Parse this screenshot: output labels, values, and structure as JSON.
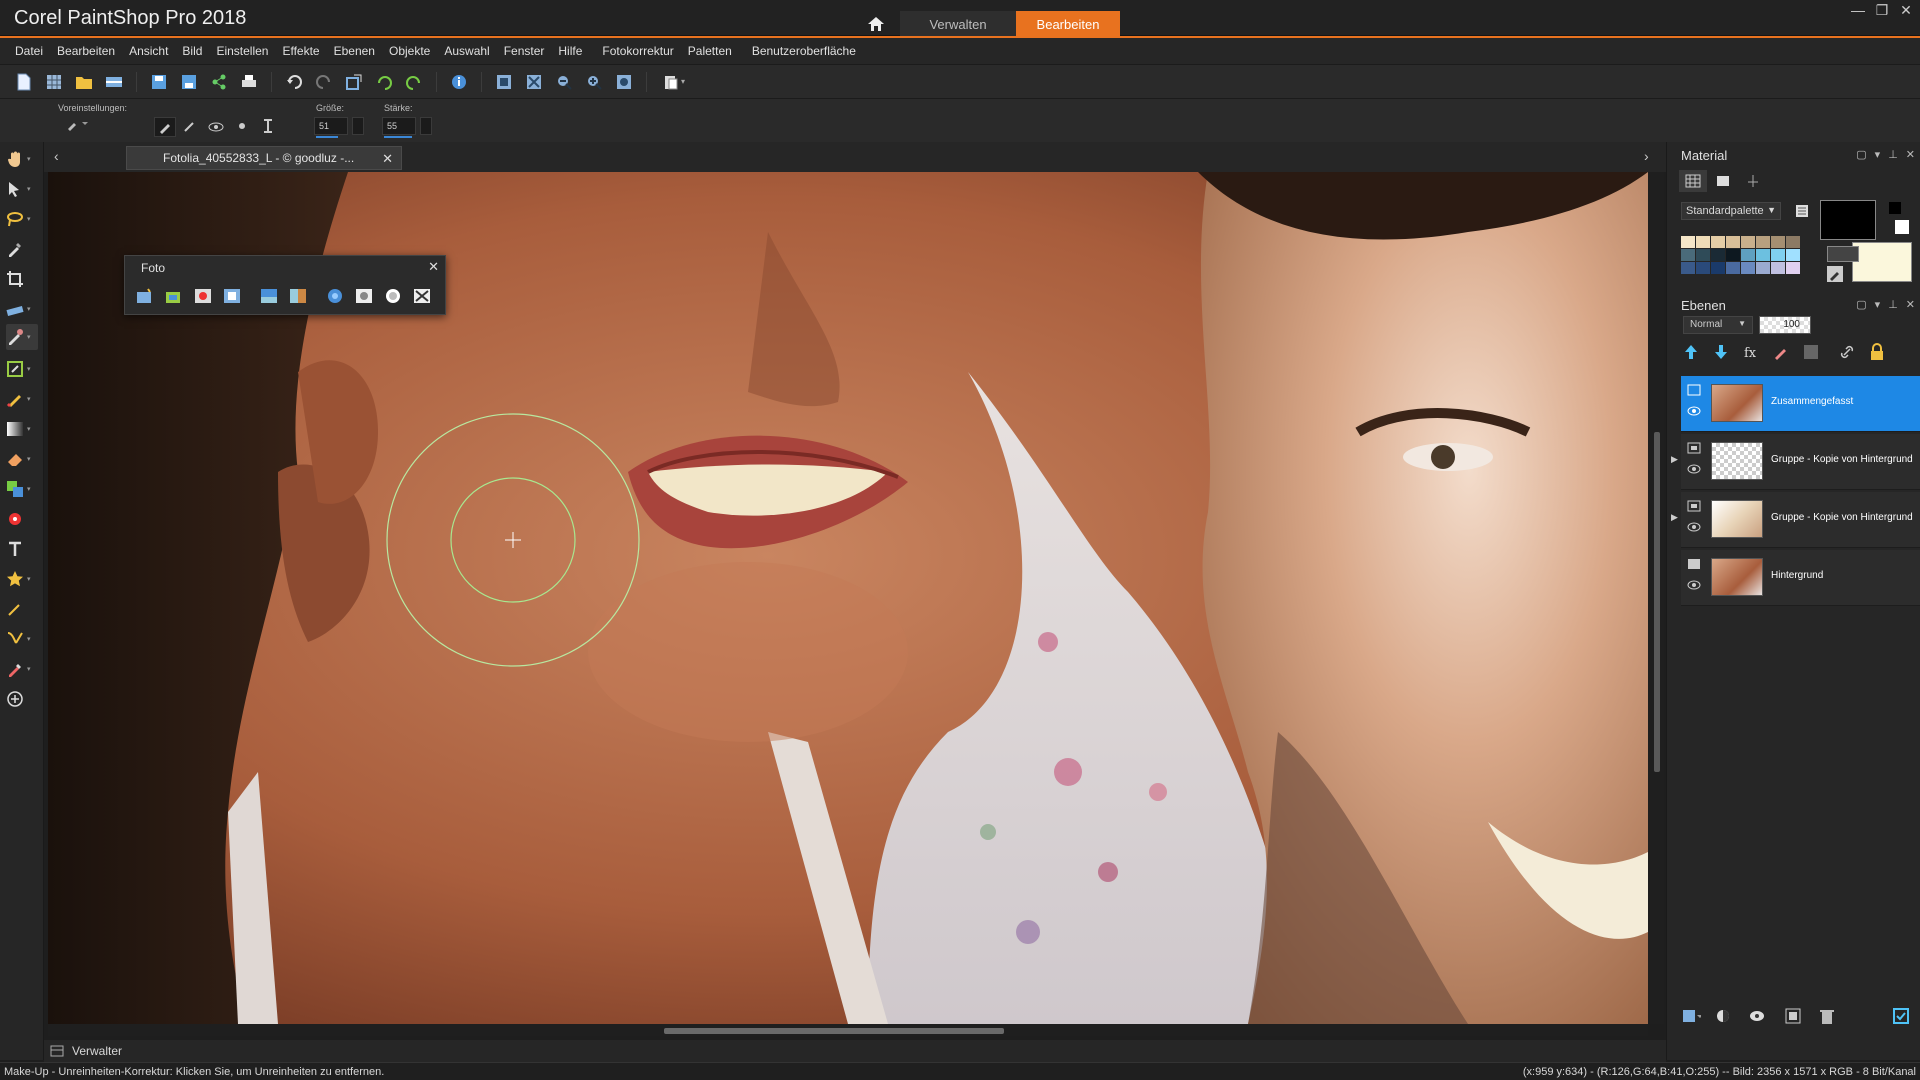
{
  "app": {
    "title": "Corel PaintShop Pro 2018",
    "tabs": [
      "Verwalten",
      "Bearbeiten"
    ],
    "active_tab": "Bearbeiten",
    "accent_color": "#e8721f"
  },
  "menu": [
    "Datei",
    "Bearbeiten",
    "Ansicht",
    "Bild",
    "Einstellen",
    "Effekte",
    "Ebenen",
    "Objekte",
    "Auswahl",
    "Fenster",
    "Hilfe",
    "Fotokorrektur",
    "Paletten",
    "Benutzeroberfläche"
  ],
  "toolbar_icons": [
    "new-icon",
    "grid-icon",
    "open-icon",
    "scan-icon",
    "save-icon",
    "save-as-icon",
    "share-icon",
    "print-icon",
    "undo-icon",
    "redo-icon",
    "resize-icon",
    "undo-history-icon",
    "redo-history-icon",
    "info-icon",
    "fit-window-icon",
    "fit-image-icon",
    "zoom-out-icon",
    "zoom-in-icon",
    "zoom-100-icon",
    "paste-icon"
  ],
  "options": {
    "presets_label": "Voreinstellungen:",
    "size_label": "Größe:",
    "size_value": "51",
    "strength_label": "Stärke:",
    "strength_value": "55"
  },
  "tools": [
    "pan-icon",
    "pick-icon",
    "lasso-icon",
    "dropper-icon",
    "crop-icon",
    "straighten-icon",
    "makeup-icon",
    "retouch-icon",
    "paint-brush-icon",
    "gradient-icon",
    "eraser-icon",
    "clone-icon",
    "red-eye-icon",
    "text-icon",
    "star-shape-icon",
    "pen-icon",
    "vector-pen-icon",
    "color-replacer-icon",
    "add-tool-icon"
  ],
  "active_tool_index": 6,
  "document": {
    "tab_label": "Fotolia_40552833_L - © goodluz -..."
  },
  "foto_palette": {
    "title": "Foto",
    "icons": [
      "auto-fix-icon",
      "smart-photo-fix-icon",
      "red-eye-fix-icon",
      "white-balance-icon",
      "brightness-icon",
      "contrast-icon",
      "local-tone-icon",
      "depth-icon",
      "haze-icon",
      "sharpen-icon"
    ]
  },
  "material": {
    "title": "Material",
    "palette_select": "Standardpalette",
    "fg_color": "#000000",
    "bg_color": "#fbf7dc",
    "swatch_colors": [
      "#f5e6c8",
      "#efdcb8",
      "#e5cda6",
      "#d9bf98",
      "#c9b08c",
      "#b8a07f",
      "#a58f72",
      "#8c7a64",
      "#4a6b7a",
      "#2f4b58",
      "#1a2a35",
      "#0d1820",
      "#5fa0c0",
      "#6cc0e0",
      "#80d0f0",
      "#a0e0ff",
      "#3a5a8a",
      "#2a4a7a",
      "#1a3a6a",
      "#4a6aa0",
      "#6a8ac0",
      "#9aaad0",
      "#c0c0e0",
      "#e0d0f0"
    ]
  },
  "layers": {
    "title": "Ebenen",
    "blend_mode": "Normal",
    "opacity": "100",
    "items": [
      {
        "name": "Zusammengefasst",
        "selected": true
      },
      {
        "name": "Gruppe - Kopie von Hintergrund",
        "selected": false
      },
      {
        "name": "Gruppe - Kopie von Hintergrund",
        "selected": false
      },
      {
        "name": "Hintergrund",
        "selected": false
      }
    ]
  },
  "bottom": {
    "tab_label": "Verwalter"
  },
  "status": {
    "left": "Make-Up - Unreinheiten-Korrektur: Klicken Sie, um Unreinheiten zu entfernen.",
    "right": "(x:959 y:634) - (R:126,G:64,B:41,O:255) -- Bild: 2356 x 1571 x RGB - 8 Bit/Kanal"
  }
}
